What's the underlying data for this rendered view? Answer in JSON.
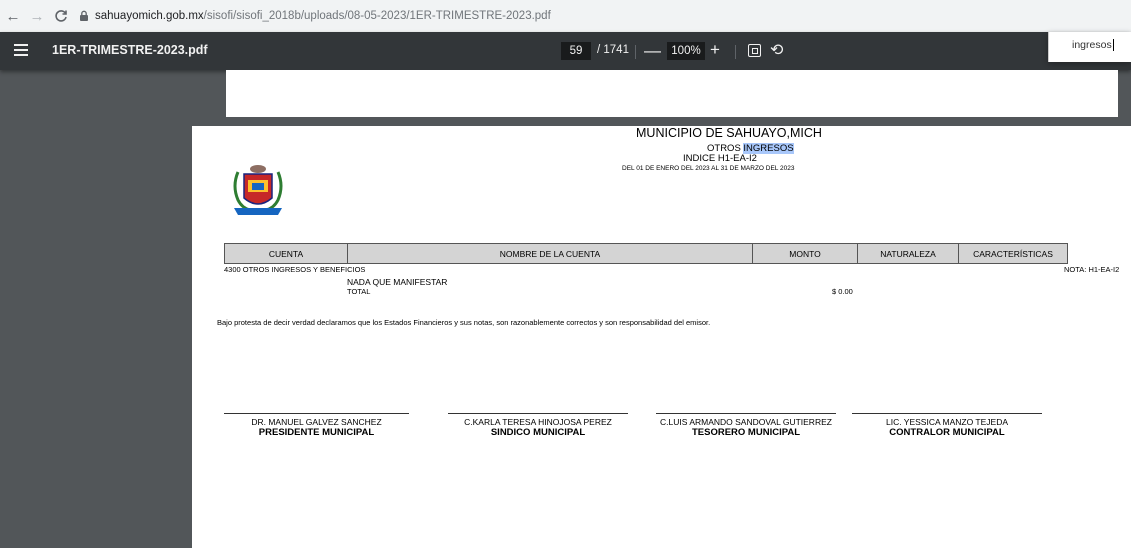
{
  "browser": {
    "back": "←",
    "forward": "→",
    "reload": "C",
    "url_host": "sahuayomich.gob.mx",
    "url_path": "/sisofi/sisofi_2018b/uploads/08-05-2023/1ER-TRIMESTRE-2023.pdf"
  },
  "pdf_toolbar": {
    "title": "1ER-TRIMESTRE-2023.pdf",
    "page_current": "59",
    "page_total": "/ 1741",
    "zoom_out": "—",
    "zoom": "100%",
    "zoom_in": "+",
    "rotate": "⟲"
  },
  "find": {
    "value": "ingresos"
  },
  "document": {
    "municipio": "MUNICIPIO DE SAHUAYO,MICH",
    "otros_prefix": "OTROS ",
    "otros_highlight": "INGRESOS",
    "indice": "INDICE H1-EA-I2",
    "periodo": "DEL 01 DE ENERO DEL 2023 AL 31 DE MARZO DEL 2023",
    "table_headers": [
      "CUENTA",
      "NOMBRE DE LA CUENTA",
      "MONTO",
      "NATURALEZA",
      "CARACTERÍSTICAS"
    ],
    "row_account": "4300  OTROS INGRESOS Y BENEFICIOS",
    "nota": "NOTA: H1-EA-I2",
    "nada": "NADA QUE MANIFESTAR",
    "total_label": "TOTAL",
    "total_value": "$ 0.00",
    "protesta": "Bajo protesta de decir verdad declaramos que los Estados Financieros y sus notas, son razonablemente correctos y son responsabilidad del emisor.",
    "signatures": [
      {
        "name": "DR. MANUEL GALVEZ SANCHEZ",
        "role": "PRESIDENTE MUNICIPAL"
      },
      {
        "name": "C.KARLA TERESA HINOJOSA PEREZ",
        "role": "SINDICO MUNICIPAL"
      },
      {
        "name": "C.LUIS ARMANDO SANDOVAL GUTIERREZ",
        "role": "TESORERO MUNICIPAL"
      },
      {
        "name": "LIC. YESSICA MANZO TEJEDA",
        "role": "CONTRALOR MUNICIPAL"
      }
    ]
  }
}
